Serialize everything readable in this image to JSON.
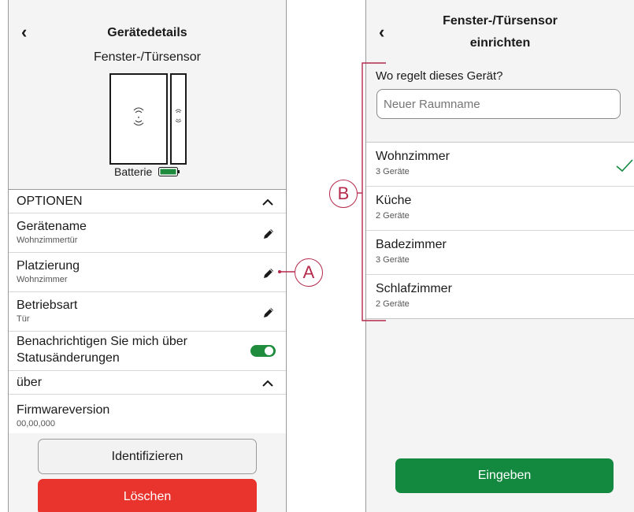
{
  "left": {
    "header_title": "Gerätedetails",
    "device_name": "Fenster-/Türsensor",
    "battery_label": "Batterie",
    "options_header": "OPTIONEN",
    "rows": [
      {
        "label": "Gerätename",
        "value": "Wohnzimmertür"
      },
      {
        "label": "Platzierung",
        "value": "Wohnzimmer"
      },
      {
        "label": "Betriebsart",
        "value": "Tür"
      }
    ],
    "notify_label_line1": "Benachrichtigen Sie mich über",
    "notify_label_line2": "Statusänderungen",
    "notify_enabled": true,
    "about_header": "über",
    "firmware_label": "Firmwareversion",
    "firmware_value": "00,00,000",
    "identify_button": "Identifizieren",
    "delete_button": "Löschen"
  },
  "right": {
    "header_title_line1": "Fenster-/Türsensor",
    "header_title_line2": "einrichten",
    "question": "Wo regelt dieses Gerät?",
    "room_input_placeholder": "Neuer Raumname",
    "rooms": [
      {
        "name": "Wohnzimmer",
        "count": "3 Geräte",
        "selected": true
      },
      {
        "name": "Küche",
        "count": "2 Geräte",
        "selected": false
      },
      {
        "name": "Badezimmer",
        "count": "3 Geräte",
        "selected": false
      },
      {
        "name": "Schlafzimmer",
        "count": "2 Geräte",
        "selected": false
      }
    ],
    "submit_button": "Eingeben"
  },
  "callouts": {
    "a": "A",
    "b": "B"
  },
  "colors": {
    "green": "#13893f",
    "red": "#e8342c",
    "callout": "#b5294b",
    "toggle": "#1e8c3c"
  },
  "icons": [
    "back-chevron-icon",
    "pencil-icon",
    "chevron-up-icon",
    "checkmark-icon",
    "battery-icon",
    "toggle-switch"
  ]
}
